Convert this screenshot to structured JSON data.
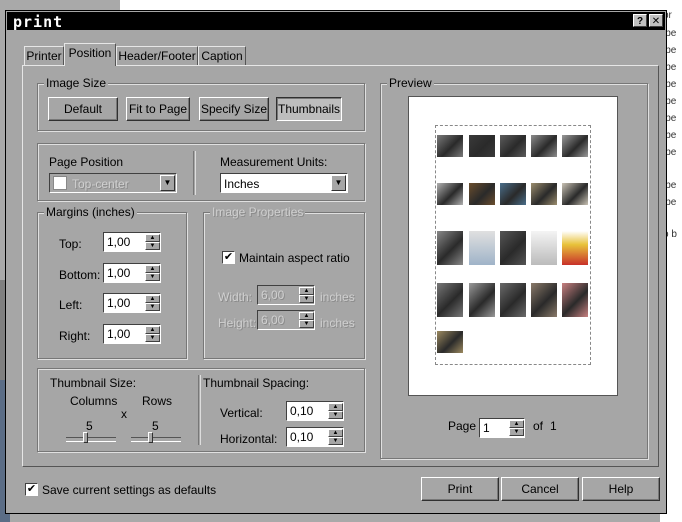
{
  "dialog": {
    "title": "print",
    "help_label": "?",
    "close_label": "✕"
  },
  "background": {
    "lines": [
      "br",
      "jpe",
      "jpe",
      "jpe",
      "jpe",
      "jpe",
      "jpe",
      "jpe",
      "jpe",
      "jpe",
      "jpe",
      "o b"
    ]
  },
  "tabs": [
    {
      "label": "Printer",
      "active": false
    },
    {
      "label": "Position",
      "active": true
    },
    {
      "label": "Header/Footer",
      "active": false
    },
    {
      "label": "Caption",
      "active": false
    }
  ],
  "image_size": {
    "title": "Image Size",
    "buttons": [
      "Default",
      "Fit to Page",
      "Specify Size",
      "Thumbnails"
    ],
    "selected": "Thumbnails"
  },
  "page_position": {
    "label": "Page Position",
    "value": "Top-center",
    "enabled": false
  },
  "measurement_units": {
    "label": "Measurement Units:",
    "value": "Inches"
  },
  "margins": {
    "title": "Margins (inches)",
    "top_label": "Top:",
    "top": "1,00",
    "bottom_label": "Bottom:",
    "bottom": "1,00",
    "left_label": "Left:",
    "left": "1,00",
    "right_label": "Right:",
    "right": "1,00"
  },
  "image_properties": {
    "title": "Image Properties",
    "maintain_label": "Maintain aspect ratio",
    "maintain_checked": true,
    "width_label": "Width:",
    "width": "6,00",
    "width_unit": "inches",
    "height_label": "Height:",
    "height": "6,00",
    "height_unit": "inches"
  },
  "thumbnail_size": {
    "label": "Thumbnail Size:",
    "columns_label": "Columns",
    "rows_label": "Rows",
    "times": "x",
    "columns": "5",
    "rows": "5"
  },
  "thumbnail_spacing": {
    "label": "Thumbnail Spacing:",
    "vertical_label": "Vertical:",
    "vertical": "0,10",
    "horizontal_label": "Horizontal:",
    "horizontal": "0,10"
  },
  "preview": {
    "label": "Preview",
    "page_label": "Page",
    "page": "1",
    "of_label": "of",
    "total": "1"
  },
  "footer": {
    "save_label": "Save current settings as defaults",
    "save_checked": true,
    "print": "Print",
    "cancel": "Cancel",
    "help": "Help"
  },
  "colors": {
    "titlebar": "#000000",
    "dialog_face": "#a6a6a6",
    "accent_yellow": "#e8c23a"
  }
}
